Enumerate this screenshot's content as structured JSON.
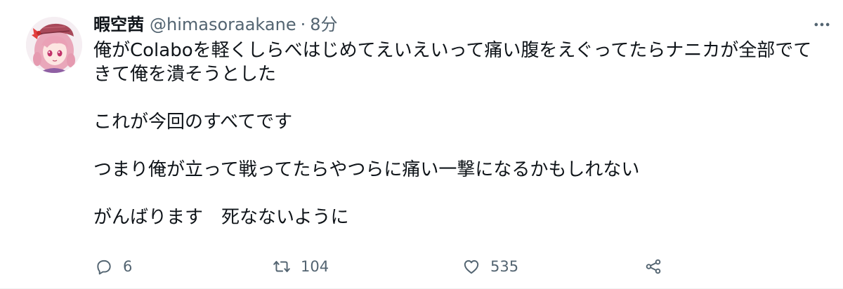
{
  "tweet": {
    "author": {
      "display_name": "暇空茜",
      "handle": "@himasoraakane",
      "avatar_icon": "anime-girl-avatar"
    },
    "separator": "·",
    "time": "8分",
    "more_icon": "more-horizontal-icon",
    "paragraphs": [
      "俺がColaboを軽くしらべはじめてえいえいって痛い腹をえぐってたらナニカが全部でてきて俺を潰そうとした",
      "これが今回のすべてです",
      "つまり俺が立って戦ってたらやつらに痛い一撃になるかもしれない",
      "がんばります　死なないように"
    ],
    "actions": {
      "reply": {
        "icon": "reply-icon",
        "count": "6"
      },
      "retweet": {
        "icon": "retweet-icon",
        "count": "104"
      },
      "like": {
        "icon": "heart-icon",
        "count": "535"
      },
      "share": {
        "icon": "share-icon"
      }
    },
    "colors": {
      "text": "#0f1419",
      "secondary": "#536471",
      "avatar_hair": "#e8a5b8",
      "avatar_hat": "#b24a5a"
    }
  }
}
